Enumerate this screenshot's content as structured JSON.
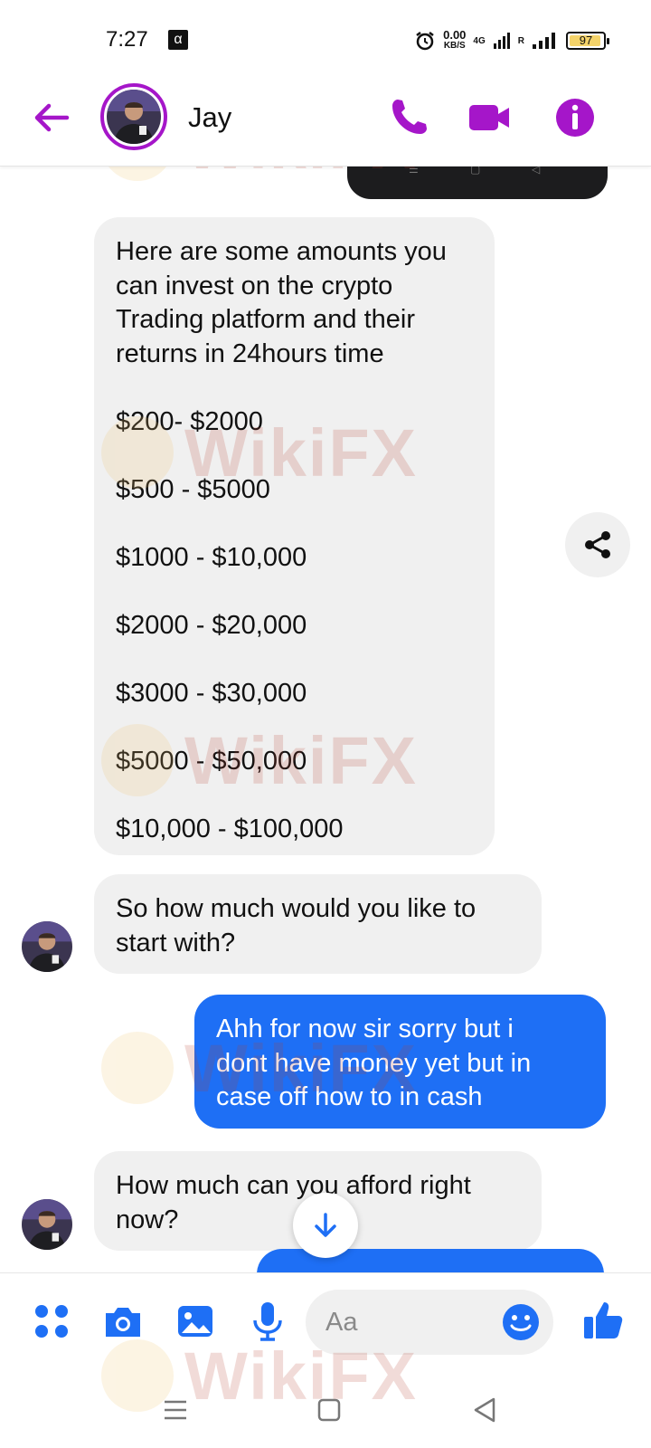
{
  "status_bar": {
    "time": "7:27",
    "alpha_glyph": "α",
    "speed_value": "0.00",
    "speed_unit": "KB/S",
    "network": "4G",
    "roaming": "R",
    "battery": "97"
  },
  "header": {
    "contact_name": "Jay",
    "accent_color": "#a516c9"
  },
  "chat": {
    "sent_top_bubble_nav": [
      "☰",
      "▢",
      "◁"
    ],
    "messages": [
      {
        "direction": "incoming",
        "lines": [
          "Here are some amounts you",
          "can invest on the crypto",
          "Trading platform and their",
          "returns in 24hours time",
          "",
          "$200- $2000",
          "",
          "$500 - $5000",
          "",
          "$1000 - $10,000",
          "",
          "$2000 - $20,000",
          "",
          "$3000 - $30,000",
          "",
          "$5000 - $50,000",
          "",
          "$10,000 - $100,000"
        ]
      },
      {
        "direction": "incoming",
        "lines": [
          "So how much would you like to",
          "start with?"
        ]
      },
      {
        "direction": "outgoing",
        "lines": [
          "Ahh for now sir sorry but i",
          "dont have money yet but in",
          "case off how to in cash"
        ]
      },
      {
        "direction": "incoming",
        "lines": [
          "How much can you afford right",
          "now?"
        ]
      }
    ],
    "outgoing_color": "#1e6ff5",
    "incoming_color": "#f0f0f0"
  },
  "composer": {
    "placeholder": "Aa",
    "icon_color": "#1e6ff5"
  },
  "watermark": {
    "text": "WikiFX"
  }
}
